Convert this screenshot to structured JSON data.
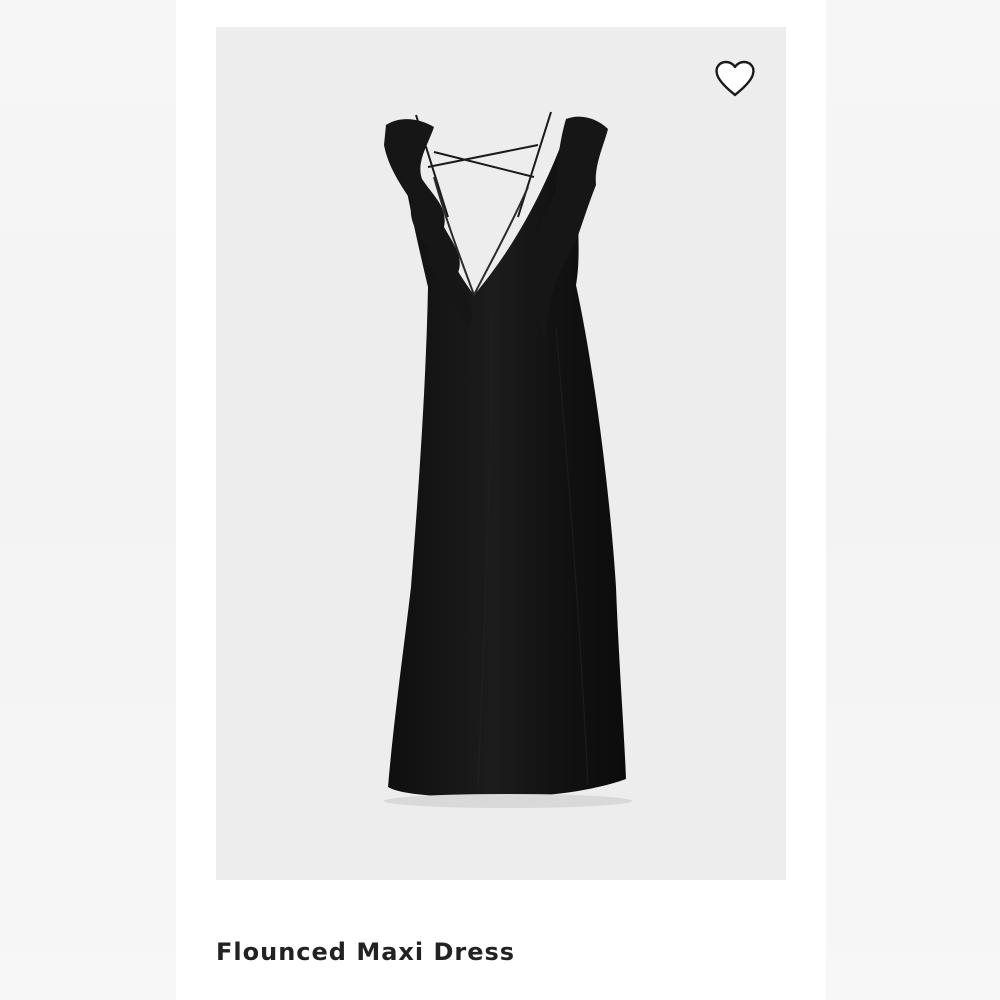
{
  "product": {
    "title": "Flounced Maxi Dress",
    "image_subject": "black flounced maxi dress",
    "favorite_icon": "heart-outline-icon"
  },
  "colors": {
    "background": "#ffffff",
    "photo_background": "#ededed",
    "dress": "#141414",
    "title_text": "#222222"
  }
}
